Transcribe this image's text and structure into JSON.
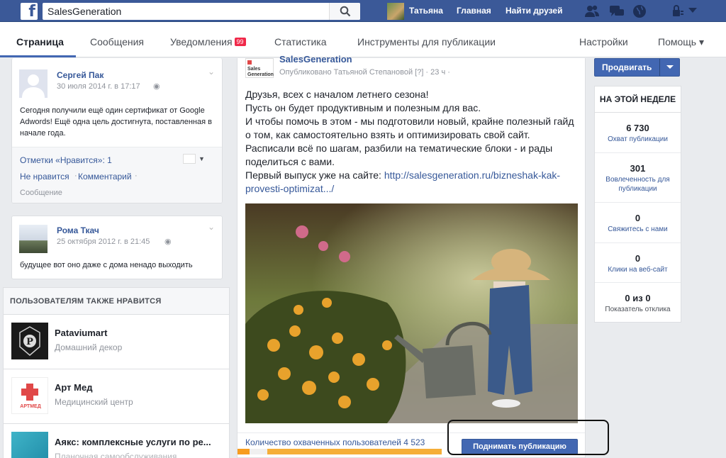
{
  "topbar": {
    "logo": "f",
    "search_value": "SalesGeneration",
    "user_name": "Татьяна",
    "home_label": "Главная",
    "find_friends_label": "Найти друзей",
    "icons": [
      "friends-icon",
      "messages-icon",
      "notifications-globe-icon",
      "privacy-lock-icon",
      "dropdown-caret-icon"
    ]
  },
  "pagetabs": {
    "items": [
      {
        "label": "Страница",
        "active": true
      },
      {
        "label": "Сообщения"
      },
      {
        "label": "Уведомления",
        "badge": "99"
      },
      {
        "label": "Статистика"
      },
      {
        "label": "Инструменты для публикации"
      }
    ],
    "settings_label": "Настройки",
    "help_label": "Помощь ▾"
  },
  "left": {
    "post1": {
      "author": "Сергей Пак",
      "date": "30 июля 2014 г. в 17:17",
      "text": "Сегодня получили ещё один сертификат от Google Adwords! Ещё одна цель достигнута, поставленная в начале года.",
      "likes_label": "Отметки «Нравится»: 1",
      "unlike_label": "Не нравится",
      "comment_label": "Комментарий",
      "type_label": "Сообщение"
    },
    "post2": {
      "author": "Рома Ткач",
      "date": "25 октября 2012 г. в 21:45",
      "text": "будущее вот оно даже с дома ненадо выходить"
    },
    "also_likes": {
      "title": "ПОЛЬЗОВАТЕЛЯМ ТАКЖЕ НРАВИТСЯ",
      "items": [
        {
          "name": "Pataviumart",
          "category": "Домашний декор"
        },
        {
          "name": "Арт Мед",
          "category": "Медицинский центр",
          "logo_text": "АРТМЕД"
        },
        {
          "name": "Аякс: комплексные услуги по ре...",
          "category": "Планочная самообслуживания"
        }
      ]
    }
  },
  "post": {
    "page_name": "SalesGeneration",
    "logo_text": "Sales Generation",
    "meta": "Опубликовано Татьяной Степановой [?] · 23 ч ·",
    "lines": [
      "Друзья, всех с началом летнего сезона!",
      "Пусть он будет продуктивным и полезным для вас.",
      "И чтобы помочь в этом - мы подготовили новый, крайне полезный гайд о том, как самостоятельно взять и оптимизировать свой сайт.",
      "Расписали всё по шагам, разбили на тематические блоки - и рады поделиться с вами.",
      "Первый выпуск уже на сайте: "
    ],
    "link": "http://salesgeneration.ru/bizneshak-kak-provesti-optimizat.../",
    "reach_label": "Количество охваченных пользователей 4 523",
    "reach_fraction": 0.06,
    "boost_label": "Поднимать публикацию"
  },
  "right": {
    "promote_label": "Продвигать",
    "week_title": "НА ЭТОЙ НЕДЕЛЕ",
    "stats": [
      {
        "value": "6 730",
        "label": "Охват публикации"
      },
      {
        "value": "301",
        "label": "Вовлеченность для публикации"
      },
      {
        "value": "0",
        "label": "Свяжитесь с нами"
      },
      {
        "value": "0",
        "label": "Клики на веб-сайт"
      },
      {
        "value": "0 из 0",
        "label": "Показатель отклика"
      }
    ]
  }
}
